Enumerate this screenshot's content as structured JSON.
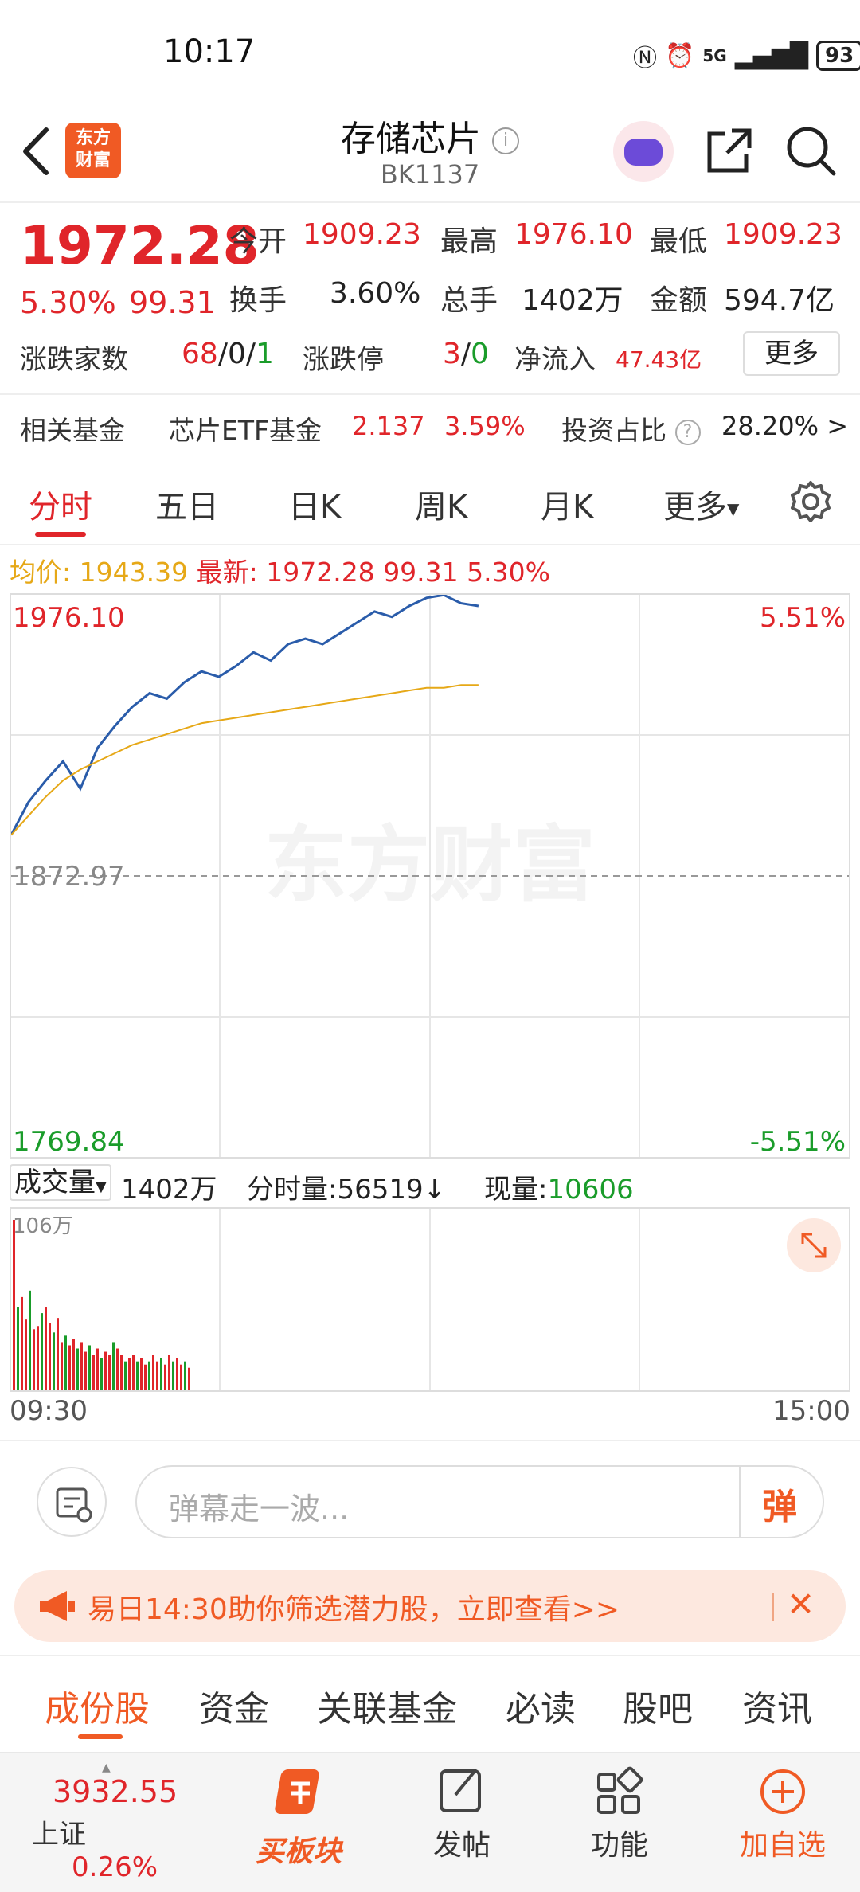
{
  "status_bar": {
    "time": "10:17",
    "network": "5G",
    "battery": "93"
  },
  "header": {
    "title": "存储芯片",
    "code": "BK1137",
    "logo_text": [
      "东方",
      "财富"
    ]
  },
  "quote": {
    "price": "1972.28",
    "change_pct": "5.30%",
    "change": "99.31",
    "open_label": "今开",
    "open": "1909.23",
    "high_label": "最高",
    "high": "1976.10",
    "low_label": "最低",
    "low": "1909.23",
    "turnover_label": "换手",
    "turnover": "3.60%",
    "volume_label": "总手",
    "volume": "1402万",
    "amount_label": "金额",
    "amount": "594.7亿",
    "breadth_label": "涨跌家数",
    "breadth_up": "68",
    "breadth_flat": "0",
    "breadth_down": "1",
    "limit_label": "涨跌停",
    "limit_up": "3",
    "limit_down": "0",
    "netflow_label": "净流入",
    "netflow": "47.43亿",
    "more_label": "更多",
    "fund_label": "相关基金",
    "fund_name": "芯片ETF基金",
    "fund_price": "2.137",
    "fund_pct": "3.59%",
    "ratio_label": "投资占比",
    "ratio": "28.20% >"
  },
  "tabs": [
    "分时",
    "五日",
    "日K",
    "周K",
    "月K",
    "更多"
  ],
  "chart_header": {
    "avg_label": "均价:",
    "avg": "1943.39",
    "latest_label": "最新:",
    "latest": "1972.28",
    "change": "99.31",
    "change_pct": "5.30%"
  },
  "chart_data": {
    "type": "line",
    "y_top": "1976.10",
    "y_mid": "1872.97",
    "y_bottom": "1769.84",
    "pct_top": "5.51%",
    "pct_bottom": "-5.51%",
    "ylim": [
      1769.84,
      1976.1
    ],
    "watermark": "东方财富",
    "series": [
      {
        "color": "#2a5caa",
        "values": [
          1888,
          1900,
          1908,
          1915,
          1905,
          1920,
          1928,
          1935,
          1940,
          1938,
          1944,
          1948,
          1946,
          1950,
          1955,
          1952,
          1958,
          1960,
          1958,
          1962,
          1966,
          1970,
          1968,
          1972,
          1975,
          1976,
          1973,
          1972
        ]
      },
      {
        "color": "#e6a817",
        "values": [
          1888,
          1895,
          1902,
          1908,
          1912,
          1915,
          1918,
          1921,
          1923,
          1925,
          1927,
          1929,
          1930,
          1931,
          1932,
          1933,
          1934,
          1935,
          1936,
          1937,
          1938,
          1939,
          1940,
          1941,
          1942,
          1942,
          1943,
          1943
        ]
      }
    ],
    "volume_max_label": "106万",
    "volume": [
      106,
      52,
      58,
      44,
      62,
      38,
      40,
      48,
      52,
      42,
      36,
      45,
      30,
      34,
      28,
      32,
      26,
      30,
      24,
      28,
      22,
      26,
      20,
      24,
      22,
      30,
      26,
      22,
      18,
      20,
      22,
      18,
      20,
      16,
      18,
      22,
      18,
      20,
      16,
      22,
      18,
      20,
      16,
      18,
      14
    ],
    "x_start": "09:30",
    "x_end": "15:00"
  },
  "volume_bar": {
    "selector": "成交量",
    "total": "1402万",
    "tick_label": "分时量:",
    "tick": "56519↓",
    "now_label": "现量:",
    "now": "10606"
  },
  "danmaku": {
    "placeholder": "弹幕走一波...",
    "button": "弹"
  },
  "banner": {
    "text": "易日14:30助你筛选潜力股，立即查看>>"
  },
  "subtabs": [
    "成份股",
    "资金",
    "关联基金",
    "必读",
    "股吧",
    "资讯"
  ],
  "bottom_nav": {
    "index_value": "3932.55",
    "index_name": "上证",
    "index_pct": "0.26%",
    "buy": "买板块",
    "post": "发帖",
    "func": "功能",
    "add": "加自选"
  }
}
